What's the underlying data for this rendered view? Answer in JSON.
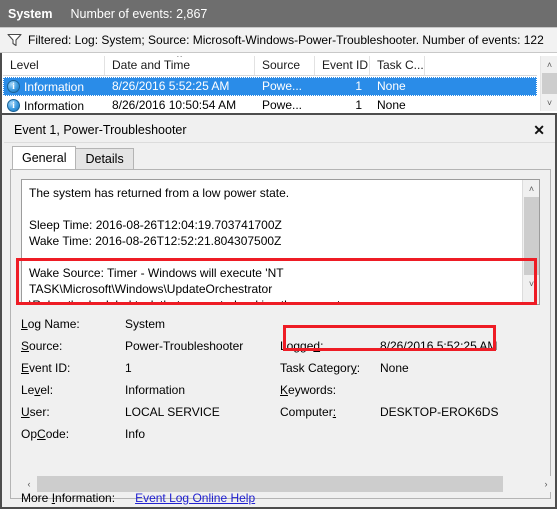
{
  "top_bar": {
    "log_name": "System",
    "events_count": "Number of events: 2,867"
  },
  "filter_bar": {
    "icon": "filter-funnel-icon",
    "text": "Filtered: Log: System; Source: Microsoft-Windows-Power-Troubleshooter. Number of events: 122"
  },
  "event_list": {
    "columns": [
      {
        "label": "Level",
        "sorted": false
      },
      {
        "label": "Date and Time",
        "sorted": true,
        "sort_glyph": "˄"
      },
      {
        "label": "Source",
        "sorted": false
      },
      {
        "label": "Event ID",
        "sorted": false
      },
      {
        "label": "Task C...",
        "sorted": false
      }
    ],
    "rows": [
      {
        "level": "Information",
        "level_icon": "information-icon",
        "date_time": "8/26/2016 5:52:25 AM",
        "source": "Powe...",
        "event_id": "1",
        "task_category": "None",
        "selected": true
      },
      {
        "level": "Information",
        "level_icon": "information-icon",
        "date_time": "8/26/2016 10:50:54 AM",
        "source": "Powe...",
        "event_id": "1",
        "task_category": "None",
        "selected": false
      }
    ],
    "scrollbar": {
      "up": "˄",
      "down": "˅"
    }
  },
  "dialog": {
    "title": "Event 1, Power-Troubleshooter",
    "close_label": "✕",
    "tabs": [
      {
        "label": "General",
        "active": true
      },
      {
        "label": "Details",
        "active": false
      }
    ],
    "description": "The system has returned from a low power state.\n\nSleep Time: 2016-08-26T12:04:19.703741700Z\nWake Time: 2016-08-26T12:52:21.804307500Z\n\nWake Source: Timer - Windows will execute 'NT TASK\\Microsoft\\Windows\\UpdateOrchestrator\n\\Reboot' scheduled task that requested waking the computer.",
    "fields": {
      "log_name_label": "Log Name:",
      "log_name_value": "System",
      "source_label": "Source:",
      "source_value": "Power-Troubleshooter",
      "event_id_label": "Event ID:",
      "event_id_value": "1",
      "level_label": "Level:",
      "level_value": "Information",
      "user_label": "User:",
      "user_value": "LOCAL SERVICE",
      "opcode_label": "OpCode:",
      "opcode_value": "Info",
      "logged_label": "Logged:",
      "logged_value": "8/26/2016 5:52:25 AM",
      "task_category_label": "Task Category:",
      "task_category_value": "None",
      "keywords_label": "Keywords:",
      "keywords_value": "",
      "computer_label": "Computer:",
      "computer_value": "DESKTOP-EROK6DS"
    },
    "more_information_label": "More Information:",
    "more_information_link": "Event Log Online Help",
    "scrollbar": {
      "up": "˄",
      "down": "˅",
      "left": "‹",
      "right": "›"
    }
  },
  "annotations": {
    "accent_color": "#ee1c25",
    "boxes": [
      {
        "name": "wake-source-highlight"
      },
      {
        "name": "logged-time-highlight"
      }
    ]
  },
  "colors": {
    "header_bar": "#6e6e6e",
    "selection": "#2a8ce8",
    "link": "#2020d0",
    "dialog_bg": "#f0f0f0"
  }
}
